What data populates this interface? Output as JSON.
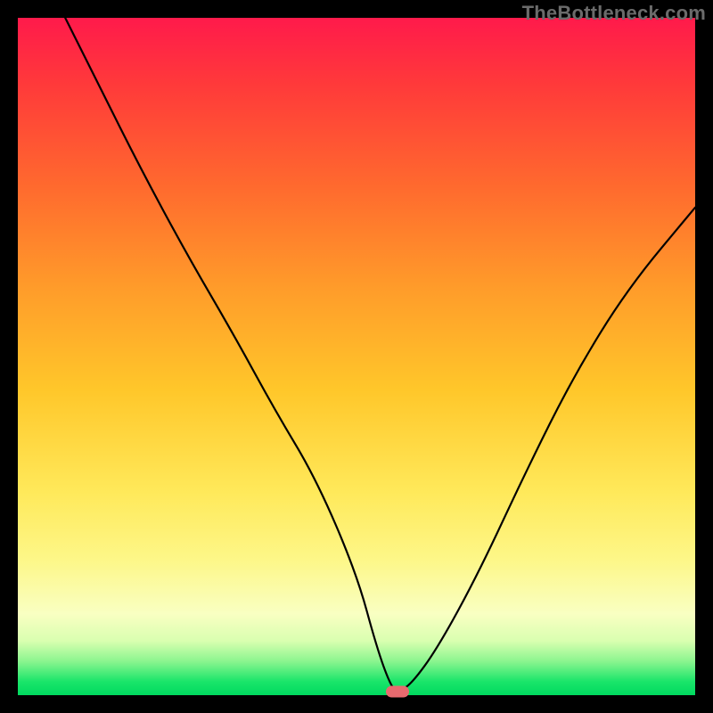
{
  "watermark": {
    "text": "TheBottleneck.com"
  },
  "colors": {
    "frame": "#000000",
    "marker": "#e76a6f",
    "curve": "#000000",
    "gradient_stops": [
      "#ff1a4b",
      "#ff3a3a",
      "#ff6a2e",
      "#ff9c2a",
      "#ffc72a",
      "#ffe95a",
      "#fdf788",
      "#f9ffc2",
      "#d9ffb0",
      "#8bf58f",
      "#1ae56a",
      "#00d95f"
    ]
  },
  "chart_data": {
    "type": "line",
    "title": "",
    "xlabel": "",
    "ylabel": "",
    "xlim": [
      0,
      100
    ],
    "ylim": [
      0,
      100
    ],
    "grid": false,
    "legend": "none",
    "annotations": [
      "TheBottleneck.com"
    ],
    "marker": {
      "x": 56,
      "y": 0.5,
      "shape": "rounded-rect"
    },
    "series": [
      {
        "name": "bottleneck-curve",
        "x": [
          7,
          12,
          18,
          25,
          32,
          38,
          44,
          50,
          53,
          55,
          56,
          58,
          62,
          68,
          75,
          82,
          90,
          100
        ],
        "y": [
          100,
          90,
          78,
          65,
          53,
          42,
          32,
          18,
          7,
          1.5,
          0.5,
          1.5,
          7,
          18,
          33,
          47,
          60,
          72
        ]
      }
    ]
  }
}
